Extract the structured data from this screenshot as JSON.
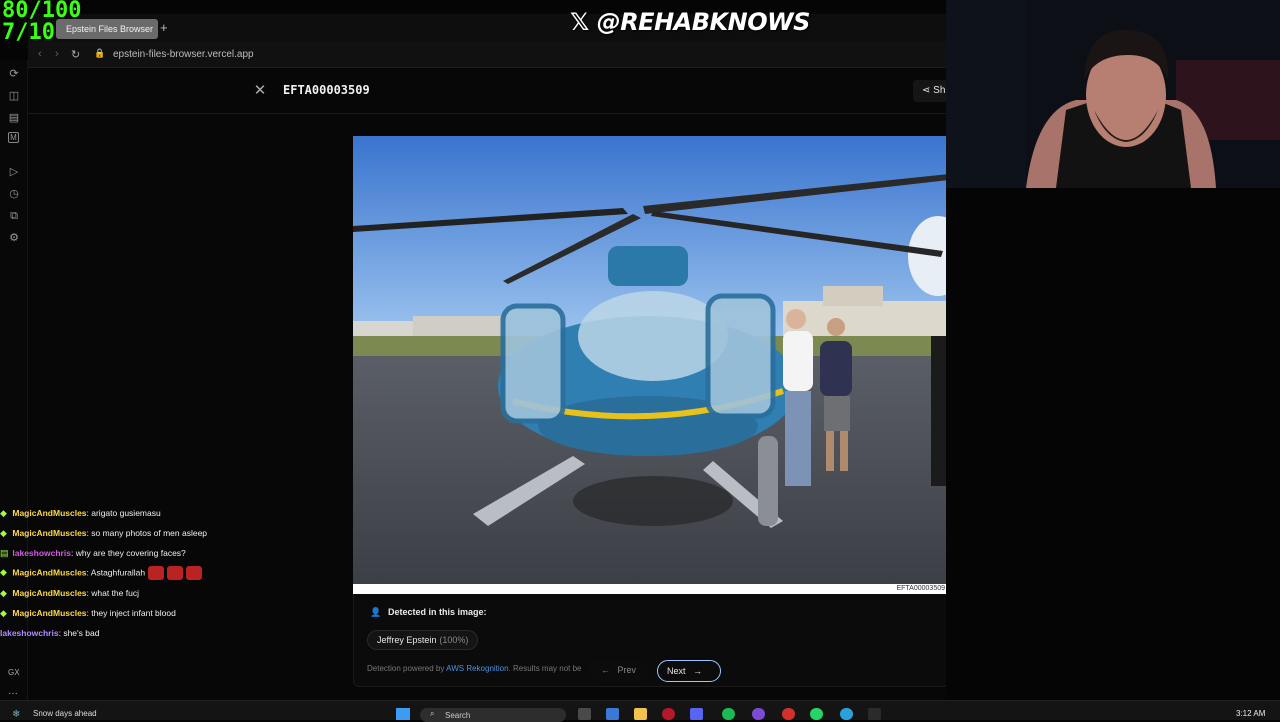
{
  "overlay": {
    "score": "80/100",
    "rating": "7/10"
  },
  "stream_handle": "𝕏 @REHABKNOWS",
  "browser": {
    "tab_title": "Epstein Files Browser",
    "new_tab": "+",
    "url": "epstein-files-browser.vercel.app"
  },
  "viewer": {
    "close": "✕",
    "doc_id": "EFTA00003509",
    "share": "Sh",
    "photo_caption": "EFTA00003509",
    "detected_heading": "Detected in this image:",
    "person_name": "Jeffrey Epstein",
    "person_confidence": "(100%)",
    "note_prefix": "Detection powered by ",
    "note_link": "AWS Rekognition",
    "note_suffix": ". Results may not be a",
    "prev": "Prev",
    "next": "Next"
  },
  "chat": [
    {
      "user": "MagicAndMuscles",
      "color": "#ffd84a",
      "message": ": arigato gusiemasu",
      "emotes": 0
    },
    {
      "user": "MagicAndMuscles",
      "color": "#ffd84a",
      "message": ": so many photos of men asleep",
      "emotes": 0
    },
    {
      "user": "lakeshowchris",
      "color": "#d05be0",
      "message": ": why are they covering faces?",
      "emotes": 0
    },
    {
      "user": "MagicAndMuscles",
      "color": "#ffd84a",
      "message": ": Astaghfurallah",
      "emotes": 3
    },
    {
      "user": "MagicAndMuscles",
      "color": "#ffd84a",
      "message": ": what the fucj",
      "emotes": 0
    },
    {
      "user": "MagicAndMuscles",
      "color": "#ffd84a",
      "message": ": they inject infant blood",
      "emotes": 0
    },
    {
      "user": "lakeshowchris",
      "color": "#b28cff",
      "message": ": she's bad",
      "emotes": 0
    }
  ],
  "sidebar_icons": [
    "refresh-icon",
    "box-icon",
    "wallet-icon",
    "m-icon",
    "play-icon",
    "history-icon",
    "puzzle-icon",
    "settings-icon"
  ],
  "side_labels": {
    "gx": "GX",
    "more": "···"
  },
  "taskbar": {
    "weather": "Snow days ahead",
    "search": "Search",
    "clock": "3:12 AM"
  }
}
